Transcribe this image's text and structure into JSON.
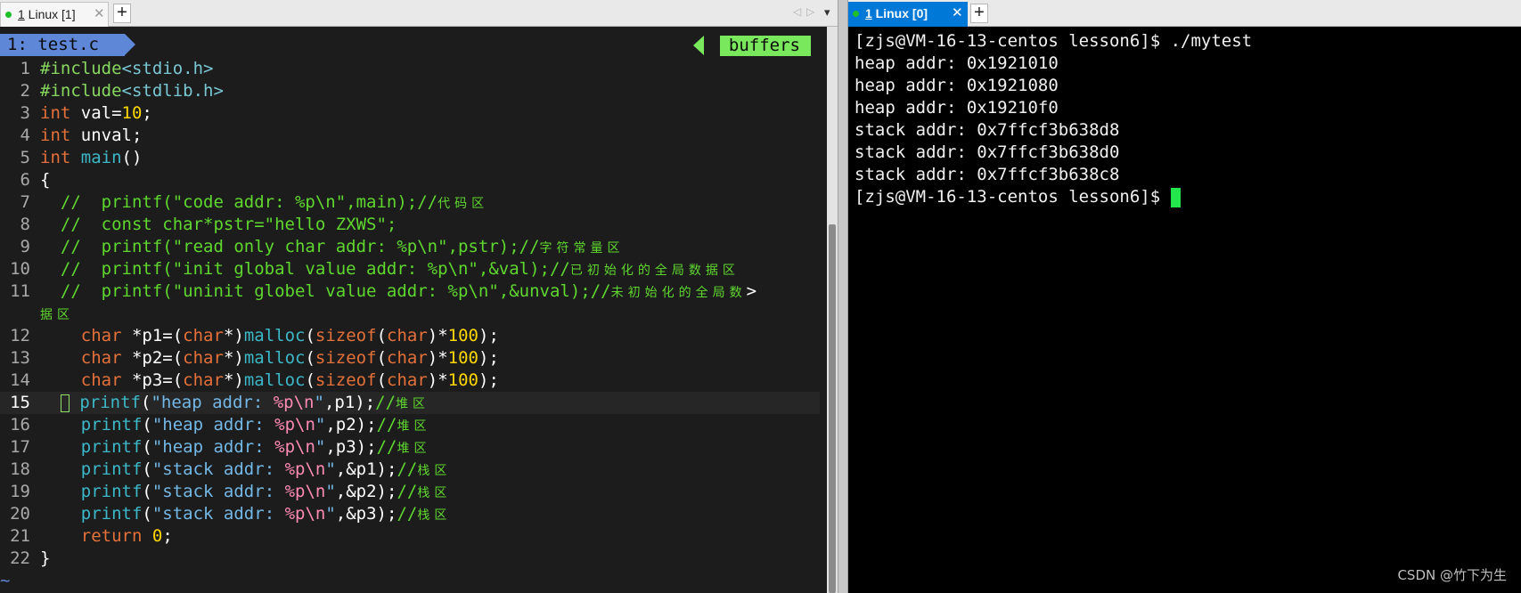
{
  "left_tabbar": {
    "tab_number": "1",
    "tab_label": " Linux [1]",
    "close": "✕",
    "add": "+",
    "nav_prev": "◁",
    "nav_next": "▷",
    "menu": "▾"
  },
  "right_tabbar": {
    "tab_number": "1",
    "tab_label": " Linux [0]",
    "close": "✕",
    "add": "+"
  },
  "colors": {
    "active_tab": "#0078d7",
    "tab_dot": "#1fbf2a",
    "vim_tab": "#5f87d7",
    "vim_buffers": "#79e85c",
    "terminal_cursor": "#22e64c"
  },
  "vim": {
    "tab_title": "1: test.c",
    "buffers_label": "buffers",
    "lines": [
      {
        "num": "1",
        "tokens": [
          {
            "c": "k-inc",
            "t": "#include"
          },
          {
            "c": "k-incf",
            "t": "<stdio.h>"
          }
        ]
      },
      {
        "num": "2",
        "tokens": [
          {
            "c": "k-inc",
            "t": "#include"
          },
          {
            "c": "k-incf",
            "t": "<stdlib.h>"
          }
        ]
      },
      {
        "num": "3",
        "tokens": [
          {
            "c": "k-type",
            "t": "int"
          },
          {
            "c": "plain",
            "t": " val="
          },
          {
            "c": "k-num",
            "t": "10"
          },
          {
            "c": "plain",
            "t": ";"
          }
        ]
      },
      {
        "num": "4",
        "tokens": [
          {
            "c": "k-type",
            "t": "int"
          },
          {
            "c": "plain",
            "t": " unval;"
          }
        ]
      },
      {
        "num": "5",
        "tokens": [
          {
            "c": "k-type",
            "t": "int"
          },
          {
            "c": "plain",
            "t": " "
          },
          {
            "c": "k-func",
            "t": "main"
          },
          {
            "c": "plain",
            "t": "()"
          }
        ]
      },
      {
        "num": "6",
        "tokens": [
          {
            "c": "plain",
            "t": "{"
          }
        ]
      },
      {
        "num": "7",
        "tokens": [
          {
            "c": "k-com",
            "t": "  //  printf(\"code addr: %p\\n\",main);//"
          },
          {
            "c": "k-com k-cjk",
            "t": "代码区"
          }
        ]
      },
      {
        "num": "8",
        "tokens": [
          {
            "c": "k-com",
            "t": "  //  const char*pstr=\"hello ZXWS\";"
          }
        ]
      },
      {
        "num": "9",
        "tokens": [
          {
            "c": "k-com",
            "t": "  //  printf(\"read only char addr: %p\\n\",pstr);//"
          },
          {
            "c": "k-com k-cjk",
            "t": "字符常量区"
          }
        ]
      },
      {
        "num": "10",
        "tokens": [
          {
            "c": "k-com",
            "t": "  //  printf(\"init global value addr: %p\\n\",&val);//"
          },
          {
            "c": "k-com k-cjk",
            "t": "已初始化的全局数据区"
          }
        ]
      },
      {
        "num": "11",
        "tokens": [
          {
            "c": "k-com",
            "t": "  //  printf(\"uninit globel value addr: %p\\n\",&unval);//"
          },
          {
            "c": "k-com k-cjk",
            "t": "未初始化的全局数"
          },
          {
            "c": "plain",
            "t": ">"
          }
        ]
      },
      {
        "num": "",
        "tokens": [
          {
            "c": "k-com k-cjk",
            "t": "据区"
          }
        ]
      },
      {
        "num": "12",
        "tokens": [
          {
            "c": "plain",
            "t": "    "
          },
          {
            "c": "k-type",
            "t": "char"
          },
          {
            "c": "plain",
            "t": " *p1=("
          },
          {
            "c": "k-type",
            "t": "char"
          },
          {
            "c": "plain",
            "t": "*)"
          },
          {
            "c": "k-func",
            "t": "malloc"
          },
          {
            "c": "plain",
            "t": "("
          },
          {
            "c": "k-type",
            "t": "sizeof"
          },
          {
            "c": "plain",
            "t": "("
          },
          {
            "c": "k-type",
            "t": "char"
          },
          {
            "c": "plain",
            "t": ")*"
          },
          {
            "c": "k-num",
            "t": "100"
          },
          {
            "c": "plain",
            "t": ");"
          }
        ]
      },
      {
        "num": "13",
        "tokens": [
          {
            "c": "plain",
            "t": "    "
          },
          {
            "c": "k-type",
            "t": "char"
          },
          {
            "c": "plain",
            "t": " *p2=("
          },
          {
            "c": "k-type",
            "t": "char"
          },
          {
            "c": "plain",
            "t": "*)"
          },
          {
            "c": "k-func",
            "t": "malloc"
          },
          {
            "c": "plain",
            "t": "("
          },
          {
            "c": "k-type",
            "t": "sizeof"
          },
          {
            "c": "plain",
            "t": "("
          },
          {
            "c": "k-type",
            "t": "char"
          },
          {
            "c": "plain",
            "t": ")*"
          },
          {
            "c": "k-num",
            "t": "100"
          },
          {
            "c": "plain",
            "t": ");"
          }
        ]
      },
      {
        "num": "14",
        "tokens": [
          {
            "c": "plain",
            "t": "    "
          },
          {
            "c": "k-type",
            "t": "char"
          },
          {
            "c": "plain",
            "t": " *p3=("
          },
          {
            "c": "k-type",
            "t": "char"
          },
          {
            "c": "plain",
            "t": "*)"
          },
          {
            "c": "k-func",
            "t": "malloc"
          },
          {
            "c": "plain",
            "t": "("
          },
          {
            "c": "k-type",
            "t": "sizeof"
          },
          {
            "c": "plain",
            "t": "("
          },
          {
            "c": "k-type",
            "t": "char"
          },
          {
            "c": "plain",
            "t": ")*"
          },
          {
            "c": "k-num",
            "t": "100"
          },
          {
            "c": "plain",
            "t": ");"
          }
        ]
      },
      {
        "num": "15",
        "current": true,
        "tokens": [
          {
            "c": "plain",
            "t": "  "
          },
          {
            "c": "cursor",
            "t": ""
          },
          {
            "c": "plain",
            "t": " "
          },
          {
            "c": "k-func",
            "t": "printf"
          },
          {
            "c": "plain",
            "t": "("
          },
          {
            "c": "k-str",
            "t": "\"heap addr: "
          },
          {
            "c": "k-esc",
            "t": "%p\\n"
          },
          {
            "c": "k-str",
            "t": "\""
          },
          {
            "c": "plain",
            "t": ",p1);"
          },
          {
            "c": "k-com",
            "t": "//"
          },
          {
            "c": "k-com k-cjk",
            "t": "堆区"
          }
        ]
      },
      {
        "num": "16",
        "tokens": [
          {
            "c": "plain",
            "t": "    "
          },
          {
            "c": "k-func",
            "t": "printf"
          },
          {
            "c": "plain",
            "t": "("
          },
          {
            "c": "k-str",
            "t": "\"heap addr: "
          },
          {
            "c": "k-esc",
            "t": "%p\\n"
          },
          {
            "c": "k-str",
            "t": "\""
          },
          {
            "c": "plain",
            "t": ",p2);"
          },
          {
            "c": "k-com",
            "t": "//"
          },
          {
            "c": "k-com k-cjk",
            "t": "堆区"
          }
        ]
      },
      {
        "num": "17",
        "tokens": [
          {
            "c": "plain",
            "t": "    "
          },
          {
            "c": "k-func",
            "t": "printf"
          },
          {
            "c": "plain",
            "t": "("
          },
          {
            "c": "k-str",
            "t": "\"heap addr: "
          },
          {
            "c": "k-esc",
            "t": "%p\\n"
          },
          {
            "c": "k-str",
            "t": "\""
          },
          {
            "c": "plain",
            "t": ",p3);"
          },
          {
            "c": "k-com",
            "t": "//"
          },
          {
            "c": "k-com k-cjk",
            "t": "堆区"
          }
        ]
      },
      {
        "num": "18",
        "tokens": [
          {
            "c": "plain",
            "t": "    "
          },
          {
            "c": "k-func",
            "t": "printf"
          },
          {
            "c": "plain",
            "t": "("
          },
          {
            "c": "k-str",
            "t": "\"stack addr: "
          },
          {
            "c": "k-esc",
            "t": "%p\\n"
          },
          {
            "c": "k-str",
            "t": "\""
          },
          {
            "c": "plain",
            "t": ",&p1);"
          },
          {
            "c": "k-com",
            "t": "//"
          },
          {
            "c": "k-com k-cjk",
            "t": "栈区"
          }
        ]
      },
      {
        "num": "19",
        "tokens": [
          {
            "c": "plain",
            "t": "    "
          },
          {
            "c": "k-func",
            "t": "printf"
          },
          {
            "c": "plain",
            "t": "("
          },
          {
            "c": "k-str",
            "t": "\"stack addr: "
          },
          {
            "c": "k-esc",
            "t": "%p\\n"
          },
          {
            "c": "k-str",
            "t": "\""
          },
          {
            "c": "plain",
            "t": ",&p2);"
          },
          {
            "c": "k-com",
            "t": "//"
          },
          {
            "c": "k-com k-cjk",
            "t": "栈区"
          }
        ]
      },
      {
        "num": "20",
        "tokens": [
          {
            "c": "plain",
            "t": "    "
          },
          {
            "c": "k-func",
            "t": "printf"
          },
          {
            "c": "plain",
            "t": "("
          },
          {
            "c": "k-str",
            "t": "\"stack addr: "
          },
          {
            "c": "k-esc",
            "t": "%p\\n"
          },
          {
            "c": "k-str",
            "t": "\""
          },
          {
            "c": "plain",
            "t": ",&p3);"
          },
          {
            "c": "k-com",
            "t": "//"
          },
          {
            "c": "k-com k-cjk",
            "t": "栈区"
          }
        ]
      },
      {
        "num": "21",
        "tokens": [
          {
            "c": "plain",
            "t": "    "
          },
          {
            "c": "k-type",
            "t": "return"
          },
          {
            "c": "plain",
            "t": " "
          },
          {
            "c": "k-num",
            "t": "0"
          },
          {
            "c": "plain",
            "t": ";"
          }
        ]
      },
      {
        "num": "22",
        "tokens": [
          {
            "c": "plain",
            "t": "}"
          }
        ]
      },
      {
        "num": "~",
        "tokens": []
      }
    ]
  },
  "terminal": {
    "lines": [
      "[zjs@VM-16-13-centos lesson6]$ ./mytest",
      "heap addr: 0x1921010",
      "heap addr: 0x1921080",
      "heap addr: 0x19210f0",
      "stack addr: 0x7ffcf3b638d8",
      "stack addr: 0x7ffcf3b638d0",
      "stack addr: 0x7ffcf3b638c8",
      "[zjs@VM-16-13-centos lesson6]$ "
    ],
    "watermark": "CSDN @竹下为生"
  }
}
